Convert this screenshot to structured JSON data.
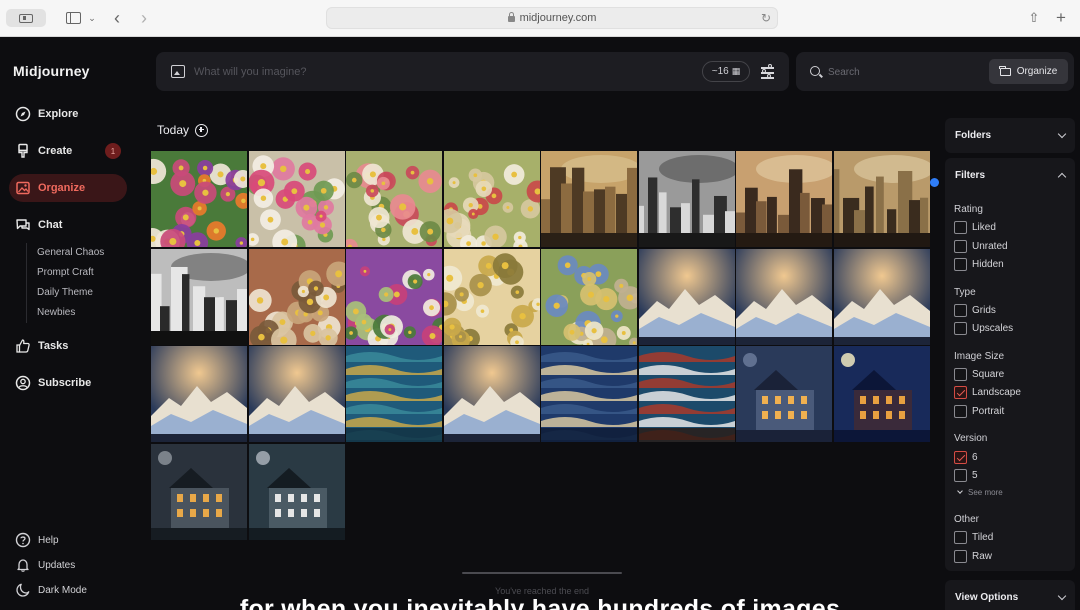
{
  "browser": {
    "url": "midjourney.com"
  },
  "app": {
    "brand": "Midjourney"
  },
  "nav": {
    "explore": "Explore",
    "create": "Create",
    "create_badge": "1",
    "organize": "Organize",
    "chat": "Chat",
    "chat_channels": [
      "General Chaos",
      "Prompt Craft",
      "Daily Theme",
      "Newbies"
    ],
    "tasks": "Tasks",
    "subscribe": "Subscribe",
    "help": "Help",
    "updates": "Updates",
    "dark_mode": "Dark Mode"
  },
  "prompt": {
    "placeholder": "What will you imagine?",
    "count_label": "~16"
  },
  "search": {
    "placeholder": "Search",
    "organize_label": "Organize"
  },
  "section": {
    "title": "Today"
  },
  "grid": {
    "tiles": [
      {
        "kind": "flowers",
        "palette": [
          "#c94a7a",
          "#f0e6d8",
          "#e97a2b",
          "#4a7a3a",
          "#8a3da0"
        ]
      },
      {
        "kind": "flowers",
        "palette": [
          "#d84a7a",
          "#f3eee4",
          "#6f9a52",
          "#c9c0a8",
          "#e07aa0"
        ]
      },
      {
        "kind": "flowers",
        "palette": [
          "#c94a5a",
          "#efe6d2",
          "#6e8a45",
          "#a8b070",
          "#e88a90"
        ]
      },
      {
        "kind": "flowers",
        "palette": [
          "#f2ecdc",
          "#d6c89e",
          "#c94a4a",
          "#a7b06a",
          "#e6d9b8"
        ]
      },
      {
        "kind": "city",
        "palette": [
          "#c7a36a",
          "#4e3a24",
          "#8c6b40",
          "#d8c090",
          "#2a2016"
        ]
      },
      {
        "kind": "city",
        "palette": [
          "#9a9a9a",
          "#2e2e2e",
          "#d8d8d8",
          "#5a5a5a",
          "#181818"
        ]
      },
      {
        "kind": "city",
        "palette": [
          "#c8a070",
          "#3a2a1e",
          "#7a5a3a",
          "#e0c8a0",
          "#241a12"
        ]
      },
      {
        "kind": "city",
        "palette": [
          "#b99a6a",
          "#3a2c1e",
          "#8a7048",
          "#dcc7a0",
          "#201812"
        ]
      },
      {
        "kind": "city",
        "palette": [
          "#bdbdbd",
          "#2a2a2a",
          "#e6e6e6",
          "#6a6a6a",
          "#101010"
        ]
      },
      {
        "kind": "flowers",
        "palette": [
          "#c9a57a",
          "#7a5a3a",
          "#efe4d0",
          "#a86a4a",
          "#d9c3a0"
        ]
      },
      {
        "kind": "flowers",
        "palette": [
          "#c7407a",
          "#f0ece0",
          "#4a7a3a",
          "#8a4aa0",
          "#a8c07a"
        ]
      },
      {
        "kind": "flowers",
        "palette": [
          "#f0e8d0",
          "#c9a84a",
          "#8a7a3a",
          "#e6d2a0",
          "#a8904a"
        ]
      },
      {
        "kind": "flowers",
        "palette": [
          "#d6c070",
          "#6a8ac0",
          "#efe6c8",
          "#8aa05a",
          "#c0b090"
        ]
      },
      {
        "kind": "wave",
        "palette": [
          "#2a3a5a",
          "#e8e0d0",
          "#9ab0d0",
          "#f0c890",
          "#1c2438"
        ]
      },
      {
        "kind": "wave",
        "palette": [
          "#2a3a5a",
          "#e8e0d0",
          "#9ab0d0",
          "#f0c890",
          "#1c2438"
        ]
      },
      {
        "kind": "wave",
        "palette": [
          "#2a3a5a",
          "#e8e0d0",
          "#9ab0d0",
          "#f0c890",
          "#1c2438"
        ]
      },
      {
        "kind": "wave",
        "palette": [
          "#2a3a5a",
          "#e8e0d0",
          "#9ab0d0",
          "#f0c890",
          "#1c2438"
        ]
      },
      {
        "kind": "wave",
        "palette": [
          "#2a3a5a",
          "#e8e0d0",
          "#9ab0d0",
          "#f0c890",
          "#1c2438"
        ]
      },
      {
        "kind": "sea",
        "palette": [
          "#1f5a7a",
          "#c9a84a",
          "#3a8a9a",
          "#e8d08a",
          "#123040"
        ]
      },
      {
        "kind": "wave",
        "palette": [
          "#2a3a5a",
          "#e8e0d0",
          "#9ab0d0",
          "#f0c890",
          "#1c2438"
        ]
      },
      {
        "kind": "sea",
        "palette": [
          "#1f3a6a",
          "#d8c8a0",
          "#3a5a8a",
          "#a89070",
          "#0e1c34"
        ]
      },
      {
        "kind": "sea",
        "palette": [
          "#1c4a6a",
          "#e8e8e8",
          "#a83a2a",
          "#3a7a9a",
          "#2a1a14"
        ]
      },
      {
        "kind": "house",
        "palette": [
          "#2a3a5a",
          "#f0b050",
          "#4a5a7a",
          "#1a2238",
          "#6a7a9a"
        ]
      },
      {
        "kind": "house",
        "palette": [
          "#182a5a",
          "#e8a040",
          "#3a2a3a",
          "#0c1638",
          "#f0e8c0"
        ]
      },
      {
        "kind": "house",
        "palette": [
          "#2a323c",
          "#e8a848",
          "#4a545e",
          "#161c22",
          "#8a9098"
        ]
      },
      {
        "kind": "house",
        "palette": [
          "#2a3a44",
          "#e6e6e6",
          "#4a5a64",
          "#141c22",
          "#a8b0b8"
        ]
      }
    ]
  },
  "panel": {
    "folders": "Folders",
    "filters": "Filters",
    "rating": {
      "title": "Rating",
      "options": [
        {
          "label": "Liked",
          "checked": false
        },
        {
          "label": "Unrated",
          "checked": false
        },
        {
          "label": "Hidden",
          "checked": false
        }
      ]
    },
    "type": {
      "title": "Type",
      "options": [
        {
          "label": "Grids",
          "checked": false
        },
        {
          "label": "Upscales",
          "checked": false
        }
      ]
    },
    "image_size": {
      "title": "Image Size",
      "options": [
        {
          "label": "Square",
          "checked": false
        },
        {
          "label": "Landscape",
          "checked": true
        },
        {
          "label": "Portrait",
          "checked": false
        }
      ]
    },
    "version": {
      "title": "Version",
      "options": [
        {
          "label": "6",
          "checked": true
        },
        {
          "label": "5",
          "checked": false
        }
      ],
      "see_more": "See more"
    },
    "other": {
      "title": "Other",
      "options": [
        {
          "label": "Tiled",
          "checked": false
        },
        {
          "label": "Raw",
          "checked": false
        }
      ]
    },
    "view_options": "View Options"
  },
  "footer": {
    "end_text": "You've reached the end"
  },
  "caption": "for when you inevitably have hundreds of images",
  "colors": {
    "accent": "#f06a5e",
    "accent_bg": "#3a1618",
    "scroll_dot": "#2f7df6"
  }
}
